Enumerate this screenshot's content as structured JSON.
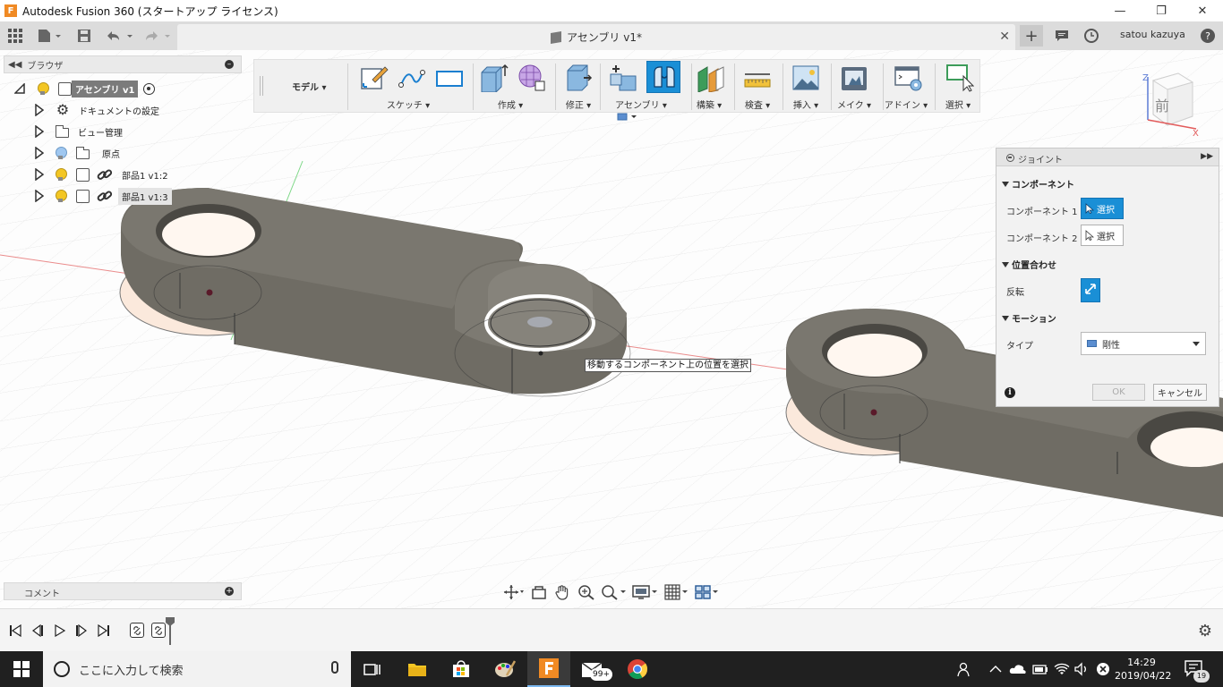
{
  "window": {
    "title": "Autodesk Fusion 360 (スタートアップ ライセンス)",
    "app_icon_letter": "F",
    "minimize": "—",
    "maximize": "❐",
    "close": "✕"
  },
  "tabbar": {
    "doc_tab": "アセンブリ v1*",
    "close_tab": "✕",
    "new_tab": "+",
    "user": "satou kazuya",
    "help": "?"
  },
  "browser": {
    "header": "ブラウザ",
    "items": [
      {
        "label": "アセンブリ v1"
      },
      {
        "label": "ドキュメントの設定"
      },
      {
        "label": "ビュー管理"
      },
      {
        "label": "原点"
      },
      {
        "label": "部品1 v1:2"
      },
      {
        "label": "部品1 v1:3"
      }
    ]
  },
  "toolbar": {
    "workspace": "モデル",
    "groups": [
      {
        "label": "スケッチ",
        "has_dropdown": true
      },
      {
        "label": "作成",
        "has_dropdown": true
      },
      {
        "label": "修正",
        "has_dropdown": true
      },
      {
        "label": "アセンブリ",
        "has_dropdown": true
      },
      {
        "label": "構築",
        "has_dropdown": true
      },
      {
        "label": "検査",
        "has_dropdown": true
      },
      {
        "label": "挿入",
        "has_dropdown": true
      },
      {
        "label": "メイク",
        "has_dropdown": true
      },
      {
        "label": "アドイン",
        "has_dropdown": true
      },
      {
        "label": "選択",
        "has_dropdown": true
      }
    ]
  },
  "dialog": {
    "title": "ジョイント",
    "section_component": "コンポーネント",
    "component1_label": "コンポーネント 1",
    "component1_button": "選択",
    "component2_label": "コンポーネント 2",
    "component2_button": "選択",
    "section_alignment": "位置合わせ",
    "flip_label": "反転",
    "section_motion": "モーション",
    "type_label": "タイプ",
    "type_value": "剛性",
    "ok": "OK",
    "cancel": "キャンセル"
  },
  "tooltip": "移動するコンポーネント上の位置を選択",
  "viewcube": {
    "face": "前",
    "axis_x": "X",
    "axis_z": "Z"
  },
  "comments": {
    "label": "コメント"
  },
  "taskbar": {
    "search_placeholder": "ここに入力して検索",
    "mail_badge": "99+",
    "time": "14:29",
    "date": "2019/04/22",
    "notification_count": "19"
  },
  "colors": {
    "accent": "#1a8fd6",
    "part_body": "#77746c",
    "axis_red": "#e25b5b",
    "axis_green": "#5fcf6a"
  }
}
